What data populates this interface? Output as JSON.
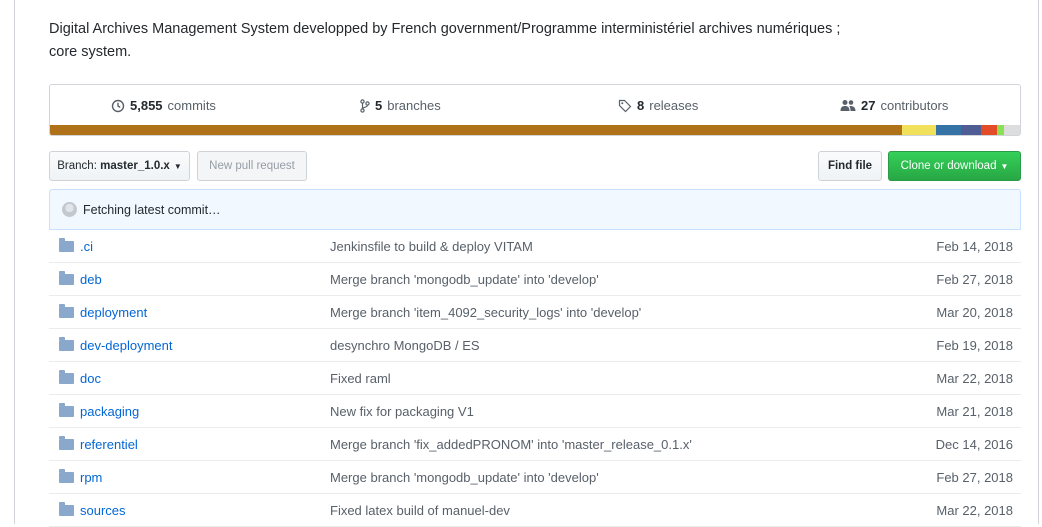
{
  "description": {
    "line1": "Digital Archives Management System developped by French government/Programme interministériel archives numériques ;",
    "line2": "core system."
  },
  "summary": {
    "commits": {
      "count": "5,855",
      "label": "commits",
      "icon": "history-icon"
    },
    "branches": {
      "count": "5",
      "label": "branches",
      "icon": "branch-icon"
    },
    "releases": {
      "count": "8",
      "label": "releases",
      "icon": "tag-icon"
    },
    "contributors": {
      "count": "27",
      "label": "contributors",
      "icon": "people-icon"
    }
  },
  "language_bar": [
    {
      "color": "#b07219",
      "fraction": 0.878
    },
    {
      "color": "#f1e05a",
      "fraction": 0.035
    },
    {
      "color": "#3572a5",
      "fraction": 0.026
    },
    {
      "color": "#4f5d95",
      "fraction": 0.021
    },
    {
      "color": "#e34c26",
      "fraction": 0.016
    },
    {
      "color": "#89e051",
      "fraction": 0.008
    },
    {
      "color": "#dddddd",
      "fraction": 0.016
    }
  ],
  "toolbar": {
    "branch_prefix": "Branch:",
    "branch_name": "master_1.0.x",
    "new_pull_request": "New pull request",
    "find_file": "Find file",
    "clone_or_download": "Clone or download"
  },
  "commit_bar": {
    "text": "Fetching latest commit…"
  },
  "files": [
    {
      "name": ".ci",
      "message": "Jenkinsfile to build & deploy VITAM",
      "age": "Feb 14, 2018"
    },
    {
      "name": "deb",
      "message": "Merge branch 'mongodb_update' into 'develop'",
      "age": "Feb 27, 2018"
    },
    {
      "name": "deployment",
      "message": "Merge branch 'item_4092_security_logs' into 'develop'",
      "age": "Mar 20, 2018"
    },
    {
      "name": "dev-deployment",
      "message": "desynchro MongoDB / ES",
      "age": "Feb 19, 2018"
    },
    {
      "name": "doc",
      "message": "Fixed raml",
      "age": "Mar 22, 2018"
    },
    {
      "name": "packaging",
      "message": "New fix for packaging V1",
      "age": "Mar 21, 2018"
    },
    {
      "name": "referentiel",
      "message": "Merge branch 'fix_addedPRONOM' into 'master_release_0.1.x'",
      "age": "Dec 14, 2016"
    },
    {
      "name": "rpm",
      "message": "Merge branch 'mongodb_update' into 'develop'",
      "age": "Feb 27, 2018"
    },
    {
      "name": "sources",
      "message": "Fixed latex build of manuel-dev",
      "age": "Mar 22, 2018"
    }
  ]
}
